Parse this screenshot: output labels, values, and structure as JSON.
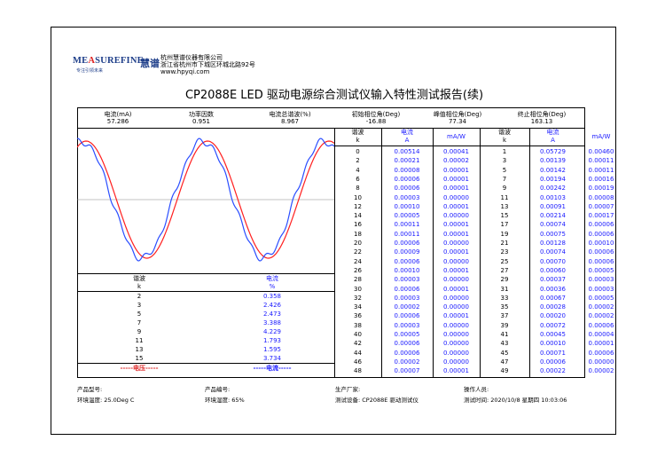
{
  "logo": {
    "word_pre": "ME",
    "word_a": "A",
    "word_mid": "SUREFINE",
    "cn": "慧谱",
    "slogan": "专注引领未来"
  },
  "company": {
    "name": "杭州慧谱仪器有限公司",
    "address": "浙江省杭州市下城区环城北路92号",
    "web": "www.hpyqi.com"
  },
  "report_title": "CP2088E LED 驱动电源综合测试仪输入特性测试报告(续)",
  "summary": {
    "headers": [
      "电流(mA)",
      "功率因数",
      "电流总谐波(%)",
      "初始相位角(Deg)",
      "峰值相位角(Deg)",
      "终止相位角(Deg)"
    ],
    "values": [
      "57.286",
      "0.951",
      "8.967",
      "-16.88",
      "77.34",
      "163.13"
    ]
  },
  "waveform": {
    "voltage_color": "#ff2020",
    "current_color": "#2a4dff"
  },
  "harm_table": {
    "header_k": "谐波",
    "header_v": "电流",
    "unit_k": "k",
    "unit_v": "%",
    "rows": [
      [
        "2",
        "0.358"
      ],
      [
        "3",
        "2.426"
      ],
      [
        "5",
        "2.473"
      ],
      [
        "7",
        "3.388"
      ],
      [
        "9",
        "4.229"
      ],
      [
        "11",
        "1.793"
      ],
      [
        "13",
        "1.595"
      ],
      [
        "15",
        "3.734"
      ]
    ],
    "legend_voltage": "-----电压-----",
    "legend_current": "-----电流-----"
  },
  "full_table": {
    "headers": [
      "谐波",
      "电流",
      "mA/W",
      "谐波",
      "电流",
      "mA/W"
    ],
    "units": [
      "k",
      "A",
      "",
      "k",
      "A",
      ""
    ],
    "rows": [
      [
        "0",
        "0.00514",
        "0.00041",
        "1",
        "0.05729",
        "0.00460"
      ],
      [
        "2",
        "0.00021",
        "0.00002",
        "3",
        "0.00139",
        "0.00011"
      ],
      [
        "4",
        "0.00008",
        "0.00001",
        "5",
        "0.00142",
        "0.00011"
      ],
      [
        "6",
        "0.00006",
        "0.00001",
        "7",
        "0.00194",
        "0.00016"
      ],
      [
        "8",
        "0.00006",
        "0.00001",
        "9",
        "0.00242",
        "0.00019"
      ],
      [
        "10",
        "0.00003",
        "0.00000",
        "11",
        "0.00103",
        "0.00008"
      ],
      [
        "12",
        "0.00010",
        "0.00001",
        "13",
        "0.00091",
        "0.00007"
      ],
      [
        "14",
        "0.00005",
        "0.00000",
        "15",
        "0.00214",
        "0.00017"
      ],
      [
        "16",
        "0.00011",
        "0.00001",
        "17",
        "0.00074",
        "0.00006"
      ],
      [
        "18",
        "0.00011",
        "0.00001",
        "19",
        "0.00075",
        "0.00006"
      ],
      [
        "20",
        "0.00006",
        "0.00000",
        "21",
        "0.00128",
        "0.00010"
      ],
      [
        "22",
        "0.00009",
        "0.00001",
        "23",
        "0.00074",
        "0.00006"
      ],
      [
        "24",
        "0.00006",
        "0.00000",
        "25",
        "0.00070",
        "0.00006"
      ],
      [
        "26",
        "0.00010",
        "0.00001",
        "27",
        "0.00060",
        "0.00005"
      ],
      [
        "28",
        "0.00003",
        "0.00000",
        "29",
        "0.00037",
        "0.00003"
      ],
      [
        "30",
        "0.00006",
        "0.00001",
        "31",
        "0.00036",
        "0.00003"
      ],
      [
        "32",
        "0.00003",
        "0.00000",
        "33",
        "0.00067",
        "0.00005"
      ],
      [
        "34",
        "0.00002",
        "0.00000",
        "35",
        "0.00028",
        "0.00002"
      ],
      [
        "36",
        "0.00006",
        "0.00001",
        "37",
        "0.00020",
        "0.00002"
      ],
      [
        "38",
        "0.00003",
        "0.00000",
        "39",
        "0.00072",
        "0.00006"
      ],
      [
        "40",
        "0.00005",
        "0.00000",
        "41",
        "0.00045",
        "0.00004"
      ],
      [
        "42",
        "0.00006",
        "0.00000",
        "43",
        "0.00010",
        "0.00001"
      ],
      [
        "44",
        "0.00006",
        "0.00000",
        "45",
        "0.00071",
        "0.00006"
      ],
      [
        "46",
        "0.00002",
        "0.00000",
        "47",
        "0.00006",
        "0.00000"
      ],
      [
        "48",
        "0.00007",
        "0.00001",
        "49",
        "0.00022",
        "0.00002"
      ]
    ]
  },
  "footer": {
    "model_label": "产品型号:",
    "serial_label": "产品编号:",
    "maker_label": "生产厂家:",
    "operator_label": "操作人员:",
    "temp": "环境温度: 25.0Deg C",
    "humidity": "环境湿度: 65%",
    "device": "测试设备: CP2088E 驱动测试仪",
    "time": "测试时间: 2020/10/8 星期四 10:03:06"
  }
}
